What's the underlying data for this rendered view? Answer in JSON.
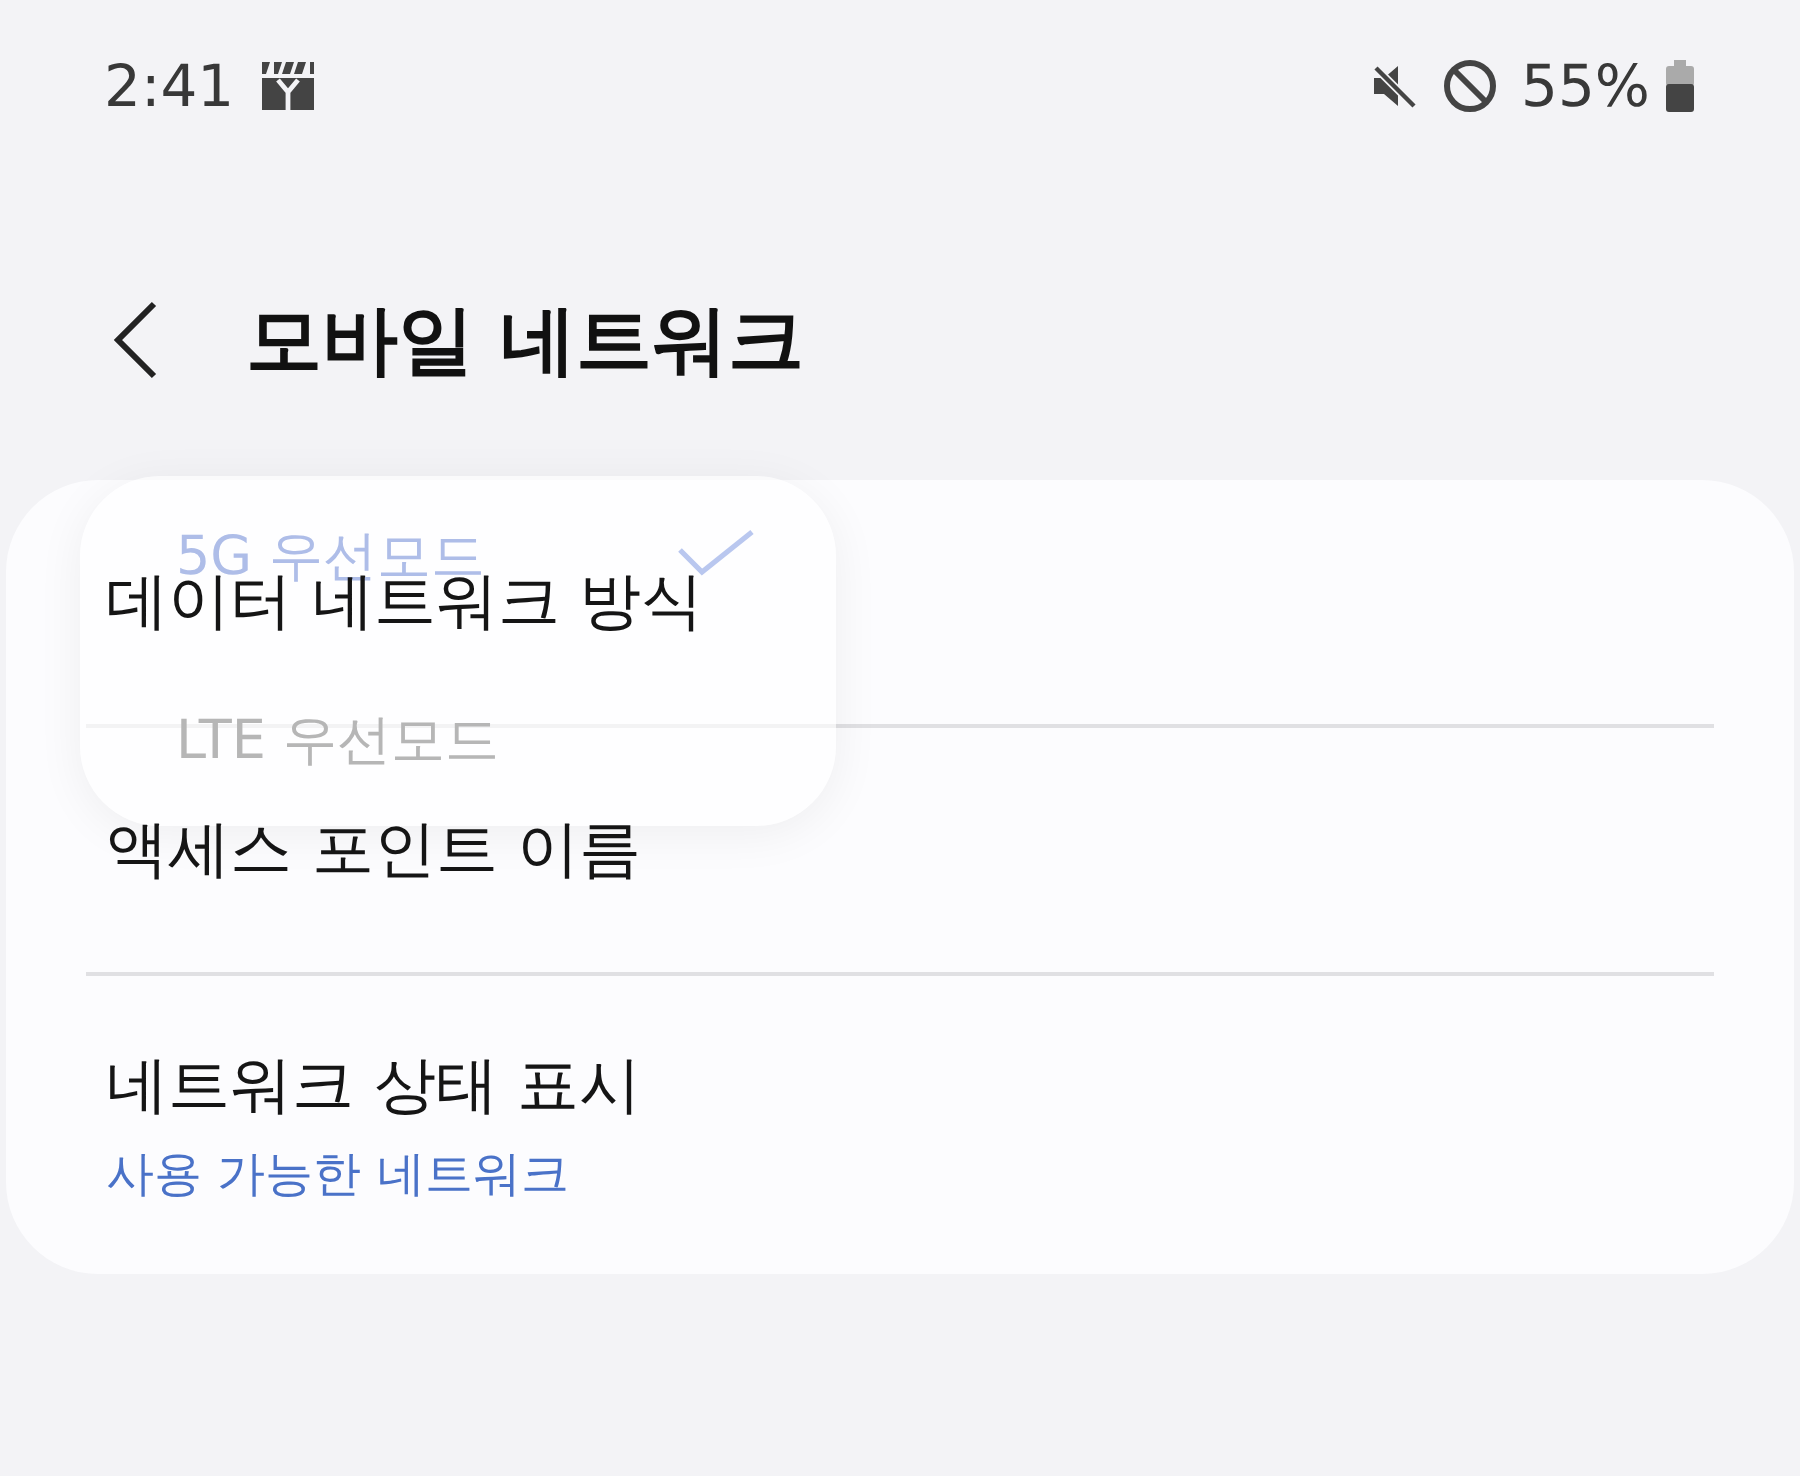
{
  "status_bar": {
    "time": "2:41",
    "battery": "55%"
  },
  "header": {
    "title": "모바일 네트워크"
  },
  "settings": [
    {
      "title": "데이터 네트워크 방식"
    },
    {
      "title": "액세스 포인트 이름"
    },
    {
      "title": "네트워크 상태 표시",
      "subtitle": "사용 가능한 네트워크"
    }
  ],
  "popup_menu": {
    "items": [
      {
        "label": "5G 우선모드",
        "selected": true
      },
      {
        "label": "LTE 우선모드",
        "selected": false
      }
    ]
  }
}
